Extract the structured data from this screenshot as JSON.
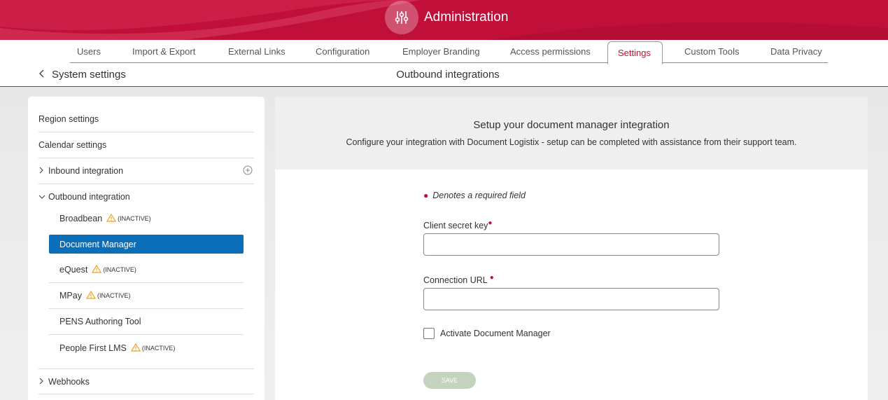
{
  "header": {
    "title": "Administration"
  },
  "tabs": [
    {
      "label": "Users"
    },
    {
      "label": "Import & Export"
    },
    {
      "label": "External Links"
    },
    {
      "label": "Configuration"
    },
    {
      "label": "Employer Branding"
    },
    {
      "label": "Access permissions"
    },
    {
      "label": "Settings",
      "active": true
    },
    {
      "label": "Custom Tools"
    },
    {
      "label": "Data Privacy"
    }
  ],
  "subheader": {
    "back_label": "System settings",
    "page_title": "Outbound integrations"
  },
  "sidebar": {
    "items": [
      {
        "label": "Region settings"
      },
      {
        "label": "Calendar settings"
      },
      {
        "label": "Inbound integration"
      },
      {
        "label": "Outbound integration"
      },
      {
        "label": "Webhooks"
      }
    ],
    "outbound_children": [
      {
        "label": "Broadbean",
        "status": "(INACTIVE)"
      },
      {
        "label": "Document Manager",
        "active": true
      },
      {
        "label": "eQuest",
        "status": "(INACTIVE)"
      },
      {
        "label": "MPay",
        "status": "(INACTIVE)"
      },
      {
        "label": "PENS Authoring Tool"
      },
      {
        "label": "People First LMS",
        "status": "(INACTIVE)"
      }
    ]
  },
  "panel": {
    "title": "Setup your document manager integration",
    "description": "Configure your integration with Document Logistix - setup can be completed with assistance from their support team.",
    "required_note": "Denotes a required field",
    "fields": {
      "client_secret_label": "Client secret key",
      "client_secret_value": "",
      "connection_url_label": "Connection URL",
      "connection_url_value": ""
    },
    "activate_label": "Activate Document Manager",
    "activate_checked": false,
    "save_label": "SAVE"
  },
  "colors": {
    "brand": "#c0103a",
    "active_item": "#0a6fb8",
    "warning": "#f0a020",
    "save_disabled": "#c3d3bd"
  }
}
